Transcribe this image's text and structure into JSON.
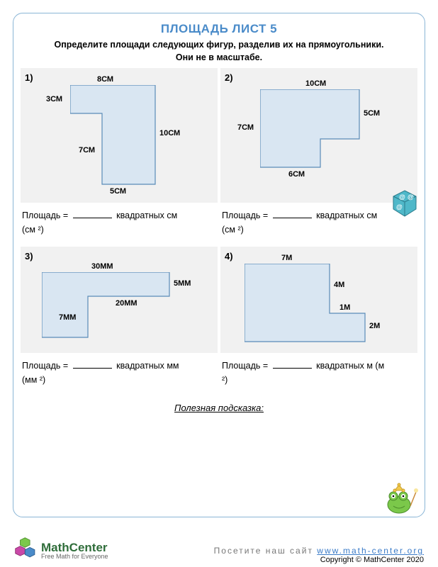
{
  "title": "ПЛОЩАДЬ ЛИСТ 5",
  "instructions_line1": "Определите площади следующих фигур, разделив их на прямоугольники.",
  "instructions_line2": "Они не в масштабе.",
  "q": {
    "1": {
      "num": "1)",
      "dims": {
        "top": "8СМ",
        "left": "3СМ",
        "right": "10СМ",
        "inner_left": "7СМ",
        "bottom": "5СМ"
      },
      "answer_prefix": "Площадь =",
      "answer_suffix": "квадратных см",
      "unit": "(см ²)"
    },
    "2": {
      "num": "2)",
      "dims": {
        "top": "10СМ",
        "left": "7СМ",
        "right": "5СМ",
        "bottom": "6СМ"
      },
      "answer_prefix": "Площадь =",
      "answer_suffix": "квадратных см",
      "unit": "(см ²)"
    },
    "3": {
      "num": "3)",
      "dims": {
        "top": "30ММ",
        "right": "5ММ",
        "inner_right": "20ММ",
        "inner_left": "7ММ"
      },
      "answer_prefix": "Площадь =",
      "answer_suffix": "квадратных мм",
      "unit": "(мм ²)"
    },
    "4": {
      "num": "4)",
      "dims": {
        "top": "7М",
        "right_upper": "4М",
        "step": "1М",
        "right_lower": "2М"
      },
      "answer_prefix": "Площадь =",
      "answer_suffix": "квадратных м (м",
      "unit": "²)"
    }
  },
  "hint": "Полезная подсказка:",
  "footer": {
    "brand": "MathCenter",
    "tagline": "Free Math for Everyone",
    "visit": "Посетите наш сайт",
    "url": "www.math-center.org",
    "copyright": "Copyright © MathCenter 2020"
  }
}
